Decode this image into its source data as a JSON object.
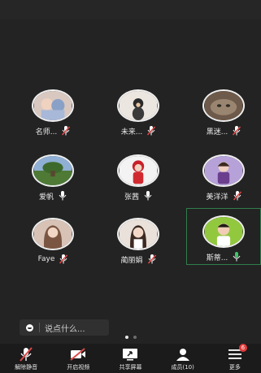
{
  "participants": [
    {
      "name": "名师...",
      "mic": "muted",
      "active": false
    },
    {
      "name": "未来...",
      "mic": "muted",
      "active": false
    },
    {
      "name": "黑迷...",
      "mic": "muted",
      "active": false
    },
    {
      "name": "爱帆",
      "mic": "on",
      "active": false
    },
    {
      "name": "张茜",
      "mic": "on",
      "active": false
    },
    {
      "name": "美洋洋",
      "mic": "muted",
      "active": false
    },
    {
      "name": "Faye",
      "mic": "muted",
      "active": false
    },
    {
      "name": "蔺丽娟",
      "mic": "muted",
      "active": false
    },
    {
      "name": "斯蒂...",
      "mic": "speaking",
      "active": true
    }
  ],
  "chat": {
    "placeholder": "说点什么..."
  },
  "pagination": {
    "count": 2,
    "current": 0
  },
  "toolbar": {
    "unmute": "解除静音",
    "video": "开启视频",
    "share": "共享屏幕",
    "members": "成员(10)",
    "more": "更多",
    "more_badge": "6"
  },
  "colors": {
    "muted": "#e04848",
    "speaking": "#41c46a",
    "active_border": "#2f7d4c"
  }
}
